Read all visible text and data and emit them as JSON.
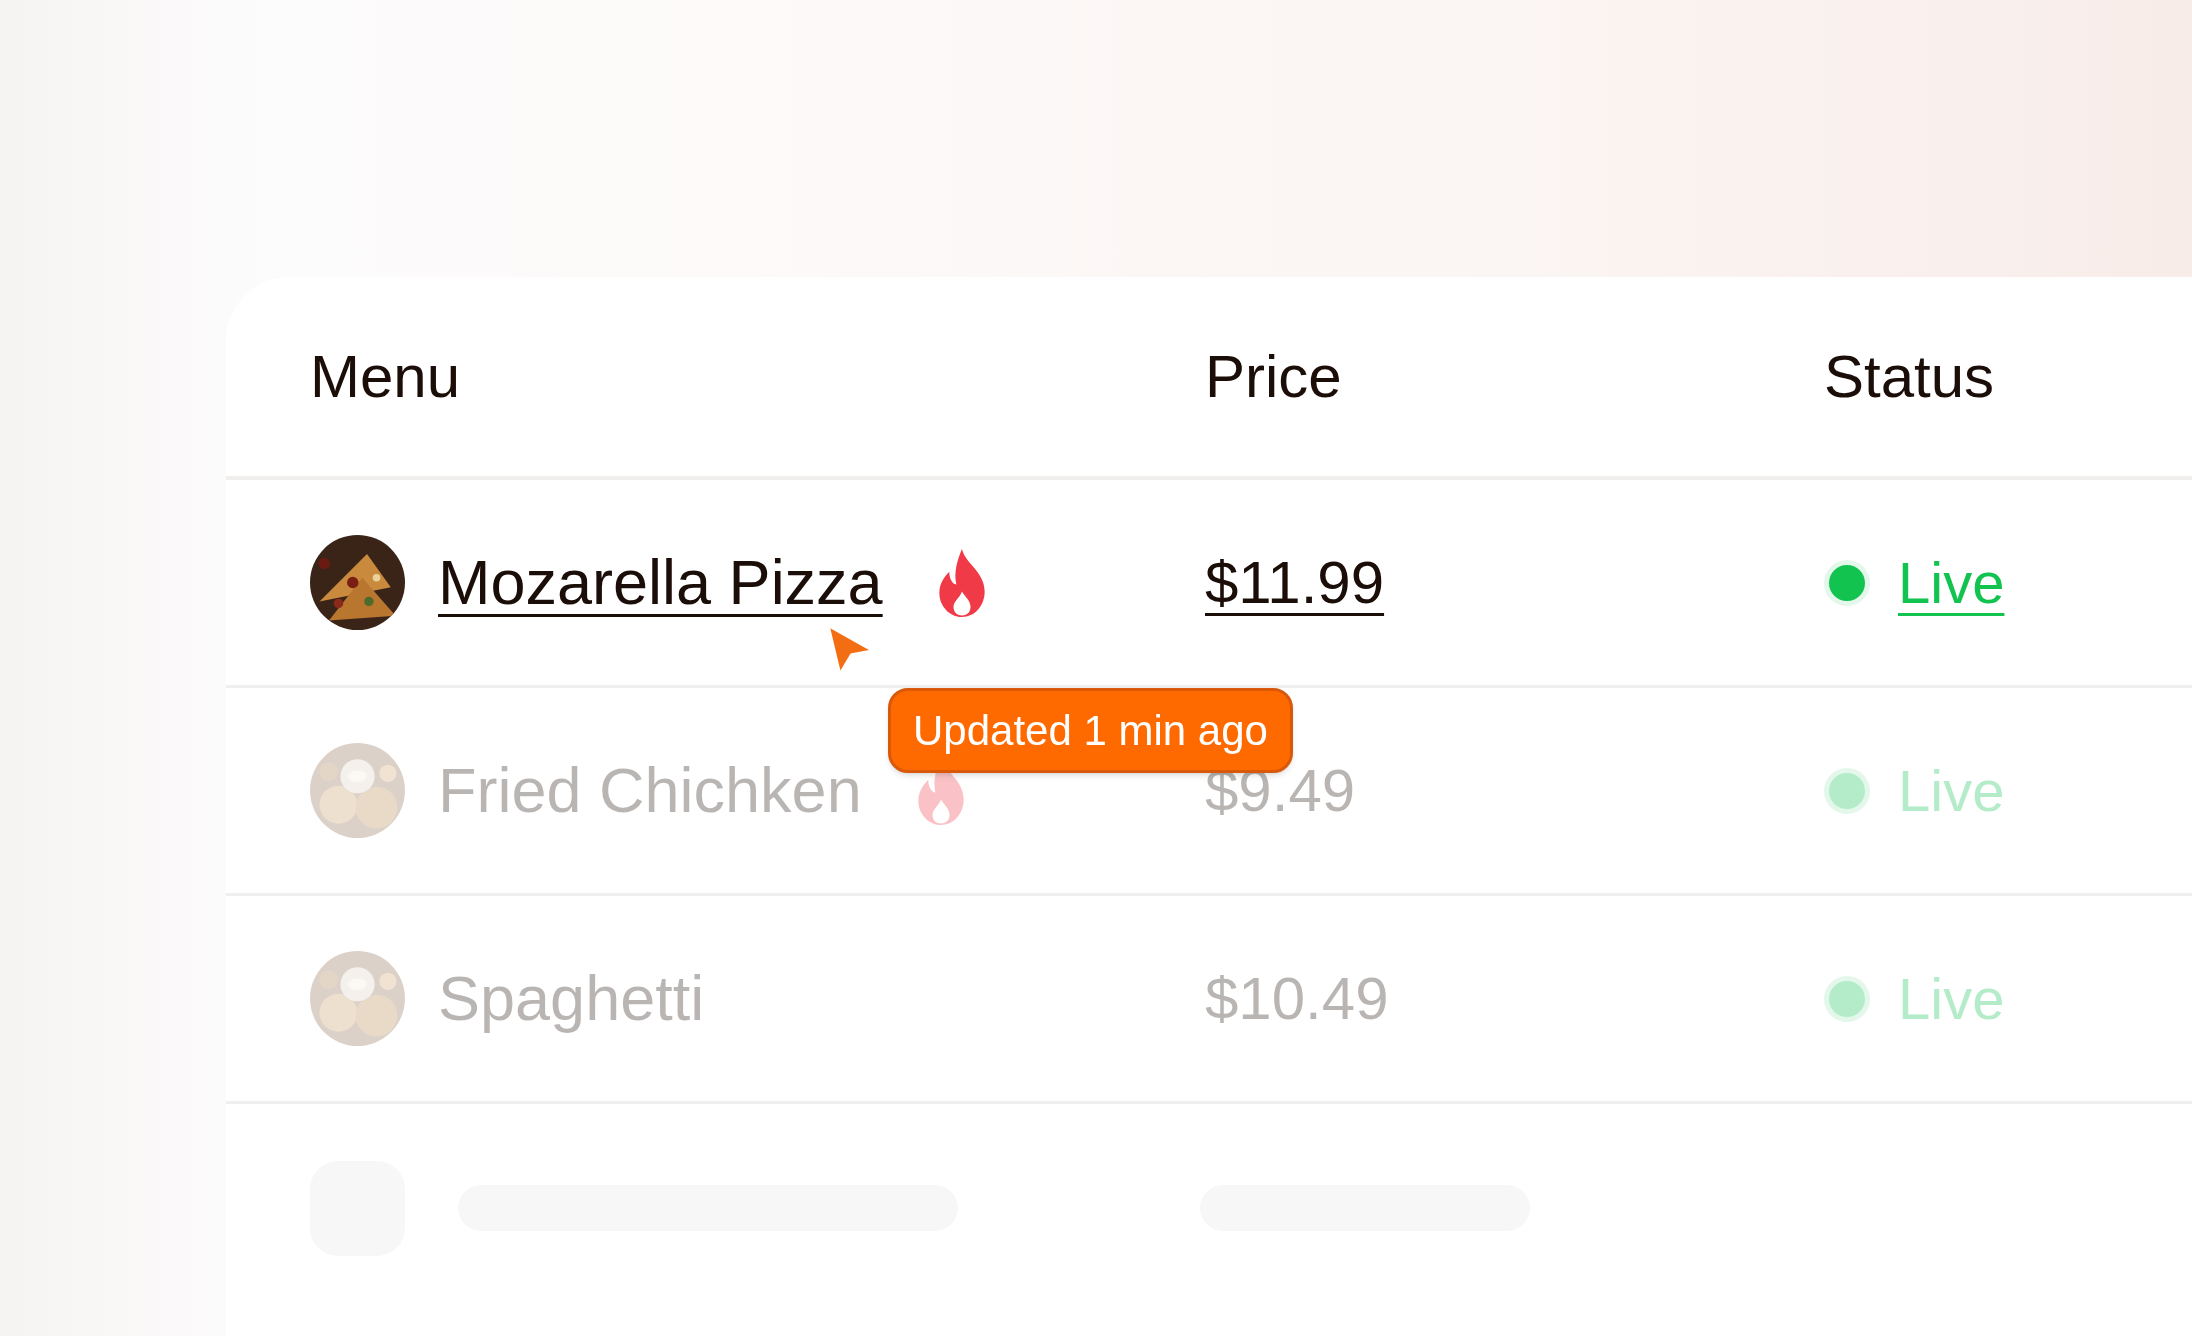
{
  "table": {
    "columns": [
      "Menu",
      "Price",
      "Status"
    ],
    "rows": [
      {
        "kind": "item",
        "selected": true,
        "name": "Mozarella Pizza",
        "trending": true,
        "price": "$11.99",
        "status": {
          "label": "Live",
          "color": "#12c350"
        },
        "tooltip": "Updated 1 min ago"
      },
      {
        "kind": "item",
        "selected": false,
        "name": "Fried Chichken",
        "trending": true,
        "price": "$9.49",
        "status": {
          "label": "Live",
          "color": "#b4ecca"
        }
      },
      {
        "kind": "item",
        "selected": false,
        "name": "Spaghetti",
        "trending": false,
        "price": "$10.49",
        "status": {
          "label": "Live",
          "color": "#b4ecca"
        }
      },
      {
        "kind": "skeleton"
      }
    ]
  }
}
